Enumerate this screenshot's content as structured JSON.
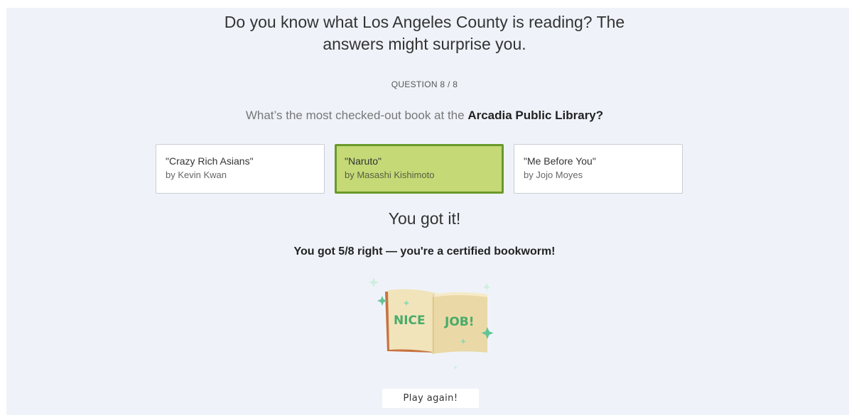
{
  "quiz": {
    "headline_line1": "Do you know what Los Angeles County is reading? The",
    "headline_line2": "answers might surprise you.",
    "counter": "QUESTION 8 / 8",
    "question_prefix": "What’s the most checked-out book at the ",
    "question_library": "Arcadia Public Library?",
    "answers": [
      {
        "title": "\"Crazy Rich Asians\"",
        "author": "by Kevin Kwan",
        "state": "default"
      },
      {
        "title": "\"Naruto\"",
        "author": "by Masashi Kishimoto",
        "state": "correct"
      },
      {
        "title": "\"Me Before You\"",
        "author": "by Jojo Moyes",
        "state": "default"
      }
    ],
    "result": "You got it!",
    "score": "You got 5/8 right — you're a certified bookworm!",
    "badge": {
      "word1": "NICE",
      "word2": "JOB!"
    },
    "play_again_label": "Play again!"
  },
  "colors": {
    "background": "#eff3f9",
    "correct_fill": "#c5d977",
    "correct_border": "#6a9a2a",
    "badge_text": "#4aaa6a",
    "book_page": "#f1e4bb",
    "book_spine": "#c8733f",
    "sparkle": "#62c496"
  }
}
